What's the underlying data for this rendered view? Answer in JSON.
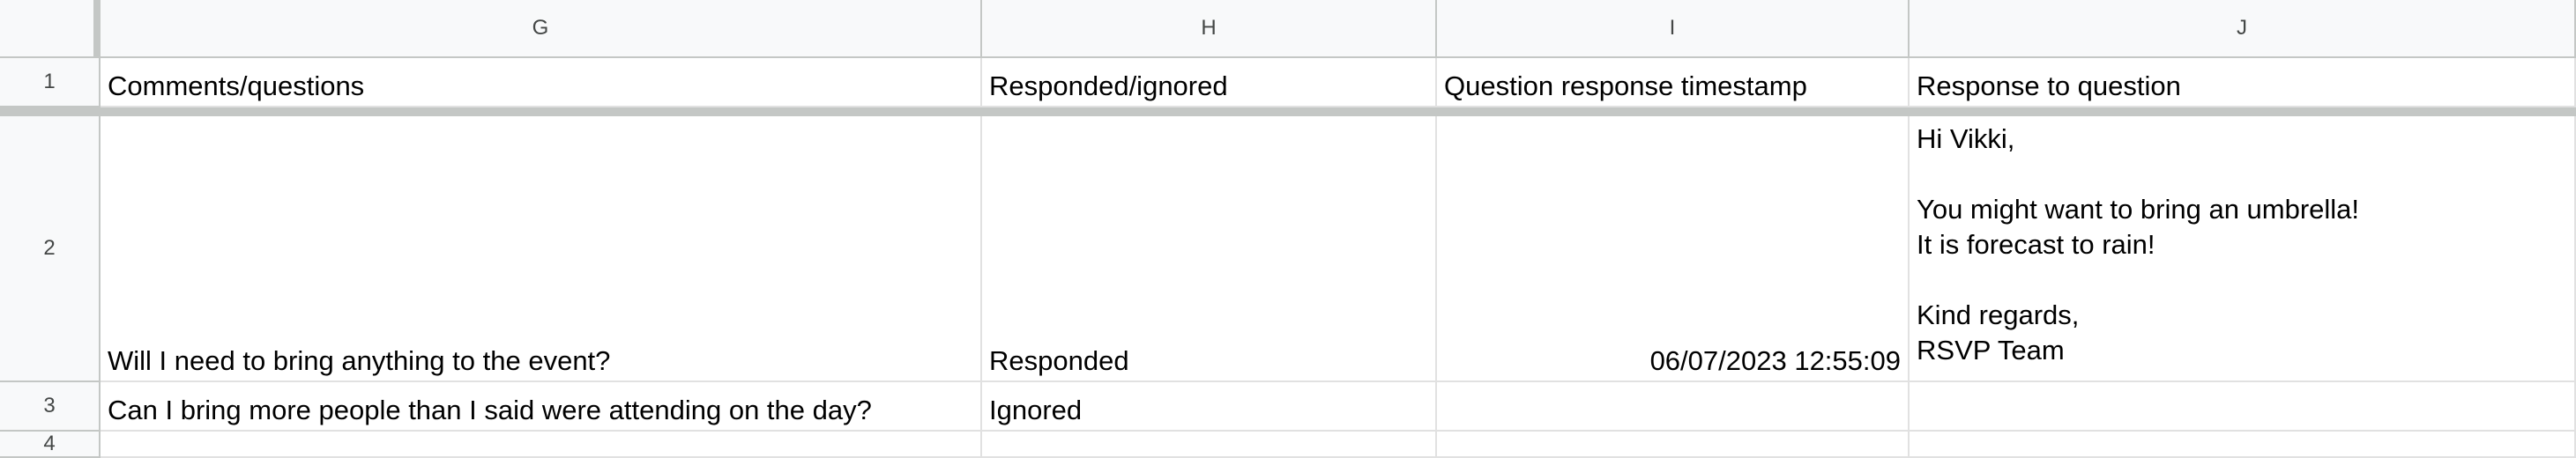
{
  "columns": [
    "G",
    "H",
    "I",
    "J"
  ],
  "rows": [
    "1",
    "2",
    "3",
    "4"
  ],
  "header_row": {
    "g": "Comments/questions",
    "h": "Responded/ignored",
    "i": "Question response timestamp",
    "j": "Response to question"
  },
  "row2": {
    "g": "Will I need to bring anything to the event?",
    "h": "Responded",
    "i": "06/07/2023 12:55:09",
    "j": "Hi Vikki,\n\nYou might want to bring an umbrella!\nIt is forecast to rain!\n\nKind regards,\nRSVP Team"
  },
  "row3": {
    "g": "Can I bring more people than I said were attending on the day?",
    "h": "Ignored",
    "i": "",
    "j": ""
  }
}
